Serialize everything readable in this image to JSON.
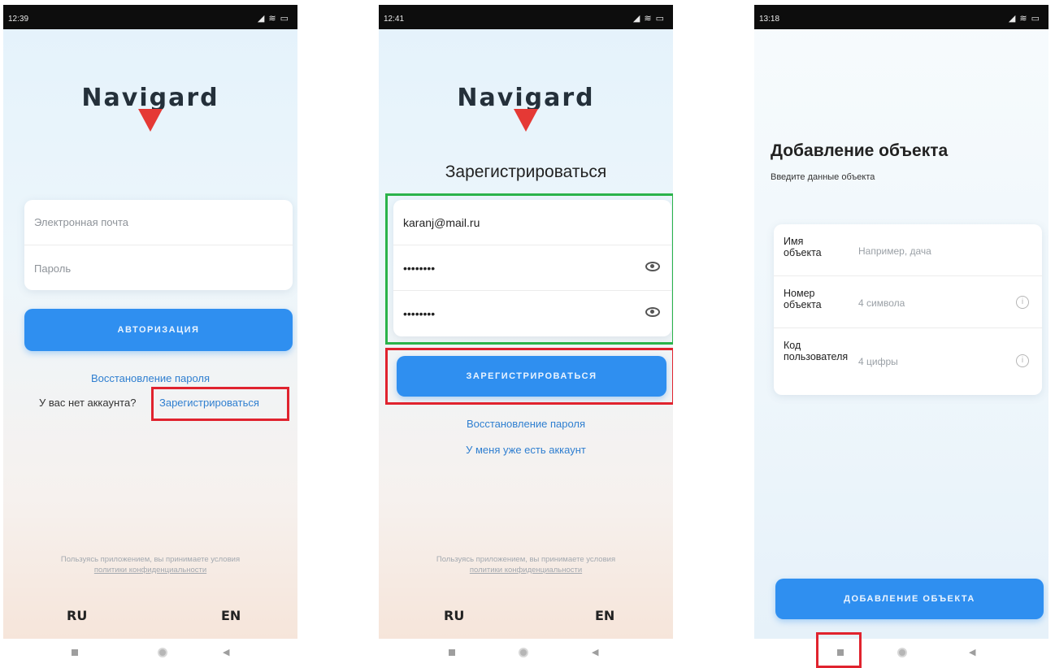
{
  "screen1": {
    "status_time": "12:39",
    "logo": "Navigard",
    "email_placeholder": "Электронная почта",
    "password_placeholder": "Пароль",
    "auth_button": "АВТОРИЗАЦИЯ",
    "recover_link": "Восстановление пароля",
    "no_account_text": "У вас нет аккаунта?",
    "register_link": "Зарегистрироваться",
    "policy_line1": "Пользуясь приложением, вы принимаете условия",
    "policy_line2": "политики конфиденциальности",
    "lang_ru": "RU",
    "lang_en": "EN"
  },
  "screen2": {
    "status_time": "12:41",
    "logo": "Navigard",
    "title": "Зарегистрироваться",
    "email_value": "karanj@mail.ru",
    "password_value": "••••••••",
    "password_confirm_value": "••••••••",
    "register_button": "ЗАРЕГИСТРИРОВАТЬСЯ",
    "recover_link": "Восстановление пароля",
    "have_account_link": "У меня уже есть аккаунт",
    "policy_line1": "Пользуясь приложением, вы принимаете условия",
    "policy_line2": "политики конфиденциальности",
    "lang_ru": "RU",
    "lang_en": "EN"
  },
  "screen3": {
    "status_time": "13:18",
    "title": "Добавление объекта",
    "subtitle": "Введите данные объекта",
    "fields": [
      {
        "label": "Имя объекта",
        "placeholder": "Например, дача"
      },
      {
        "label": "Номер объекта",
        "placeholder": "4 символа"
      },
      {
        "label": "Код пользователя",
        "placeholder": "4 цифры"
      }
    ],
    "add_button": "ДОБАВЛЕНИЕ ОБЪЕКТА"
  },
  "status_icons": "◢ ≋ ▭",
  "nav_back_glyph": "◀",
  "info_glyph": "i",
  "colors": {
    "accent": "#2f8ff0",
    "link": "#2f7fd0",
    "highlight_red": "#e0232e",
    "highlight_green": "#2bb34a",
    "logo_triangle": "#e53935"
  }
}
